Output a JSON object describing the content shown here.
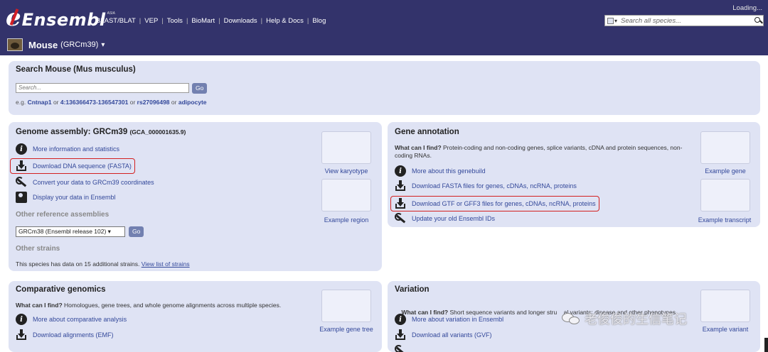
{
  "header": {
    "logo_e": "e",
    "logo_word": "Ensembl",
    "logo_tag": "ASIA",
    "nav": [
      "BLAST/BLAT",
      "VEP",
      "Tools",
      "BioMart",
      "Downloads",
      "Help & Docs",
      "Blog"
    ],
    "loading": "Loading...",
    "search_placeholder": "Search all species..."
  },
  "species_bar": {
    "name": "Mouse",
    "assembly": "(GRCm39)",
    "caret": "▾"
  },
  "search_panel": {
    "title": "Search Mouse (Mus musculus)",
    "placeholder": "Search...",
    "go": "Go",
    "example_prefix": "e.g.",
    "examples": [
      "Cntnap1",
      "4:136366473-136547301",
      "rs27096498",
      "adipocyte"
    ],
    "or": "or"
  },
  "genome_panel": {
    "title": "Genome assembly: GRCm39",
    "accession": "(GCA_000001635.9)",
    "links": [
      "More information and statistics",
      "Download DNA sequence (FASTA)",
      "Convert your data to GRCm39 coordinates",
      "Display your data in Ensembl"
    ],
    "other_assemblies_heading": "Other reference assemblies",
    "assembly_select": "GRCm38 (Ensembl release 102) ▾",
    "go": "Go",
    "other_strains_heading": "Other strains",
    "strains_text": "This species has data on 15 additional strains.",
    "strains_link": "View list of strains",
    "thumb_karyotype": "View karyotype",
    "thumb_region": "Example region"
  },
  "gene_panel": {
    "title": "Gene annotation",
    "what_label": "What can I find?",
    "what_text": "Protein-coding and non-coding genes, splice variants, cDNA and protein sequences, non-coding RNAs.",
    "links": [
      "More about this genebuild",
      "Download FASTA files for genes, cDNAs, ncRNA, proteins",
      "Download GTF or GFF3 files for genes, cDNAs, ncRNA, proteins",
      "Update your old Ensembl IDs"
    ],
    "thumb_gene": "Example gene",
    "thumb_transcript": "Example transcript"
  },
  "comparative_panel": {
    "title": "Comparative genomics",
    "what_label": "What can I find?",
    "what_text": "Homologues, gene trees, and whole genome alignments across multiple species.",
    "links": [
      "More about comparative analysis",
      "Download alignments (EMF)"
    ],
    "thumb_tree": "Example gene tree"
  },
  "variation_panel": {
    "title": "Variation",
    "what_label": "What can I find?",
    "what_text": "Short sequence variants and longer stru    al variants; disease and other phenotypes",
    "links": [
      "More about variation in Ensembl",
      "Download all variants (GVF)"
    ],
    "thumb_variant": "Example variant"
  },
  "watermark": "老俊俊的生信笔记"
}
